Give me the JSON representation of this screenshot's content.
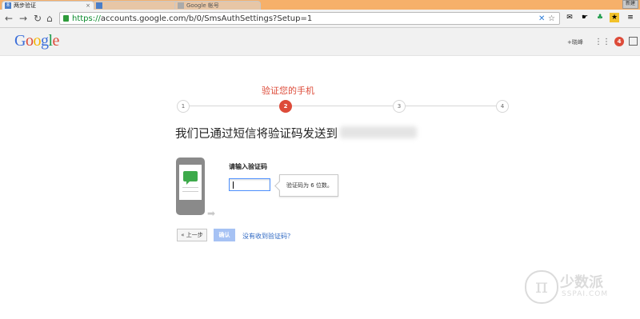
{
  "browser": {
    "tabs": [
      {
        "title": "两步验证",
        "active": true
      },
      {
        "title": "",
        "active": false
      },
      {
        "title": "Google 帐号",
        "active": false
      }
    ],
    "window_button": "新建",
    "url_scheme": "https://",
    "url_rest": "accounts.google.com/b/0/SmsAuthSettings?Setup=1"
  },
  "header": {
    "logo_letters": [
      "G",
      "o",
      "o",
      "g",
      "l",
      "e"
    ],
    "plus_name": "+晓峰",
    "notification_count": "4"
  },
  "wizard": {
    "title": "验证您的手机",
    "steps": [
      "1",
      "2",
      "3",
      "4"
    ],
    "active_step": 2,
    "headline": "我们已通过短信将验证码发送到",
    "code_label": "请输入验证码",
    "tip": "验证码为 6 位数。",
    "back_button": "« 上一步",
    "confirm_button": "确认",
    "no_code_link": "没有收到验证码？"
  },
  "watermark": {
    "symbol": "π",
    "cn": "少数派",
    "en": "SSPAI.COM"
  }
}
